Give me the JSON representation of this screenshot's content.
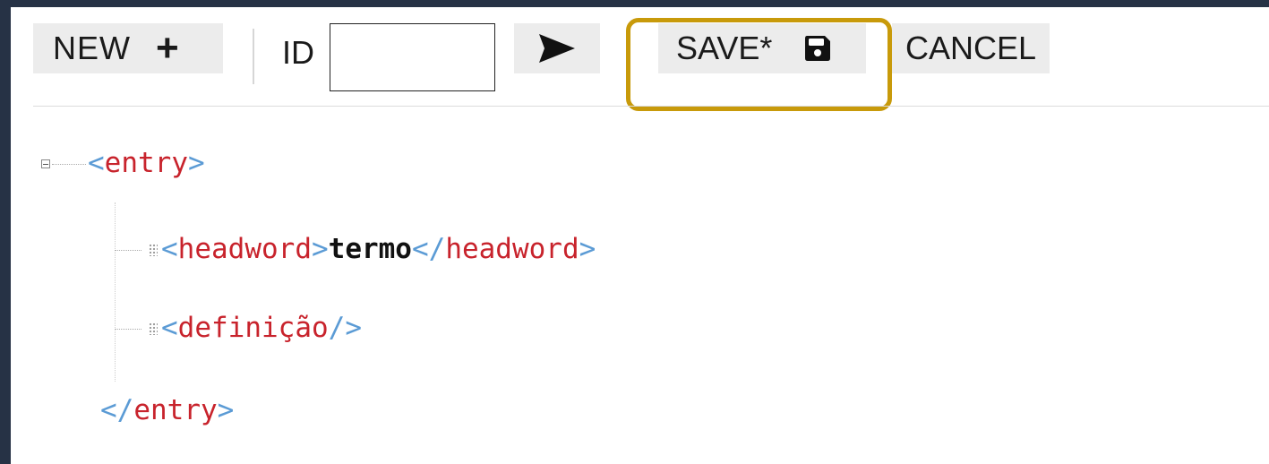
{
  "toolbar": {
    "new_label": "NEW",
    "new_icon": "plus-icon",
    "id_label": "ID",
    "id_value": "",
    "go_icon": "send-arrow-icon",
    "save_label": "SAVE*",
    "save_icon": "floppy-disk-icon",
    "cancel_label": "CANCEL",
    "highlight_color": "#c89a0a"
  },
  "tree": {
    "root_open": "<entry>",
    "root_tag": "entry",
    "children": [
      {
        "tag": "headword",
        "text": "termo"
      },
      {
        "tag": "definição",
        "self_closing": true
      }
    ],
    "root_close_tag": "entry"
  },
  "colors": {
    "bracket": "#5b9bd5",
    "tag": "#c8232c",
    "background_frame": "#263245"
  }
}
